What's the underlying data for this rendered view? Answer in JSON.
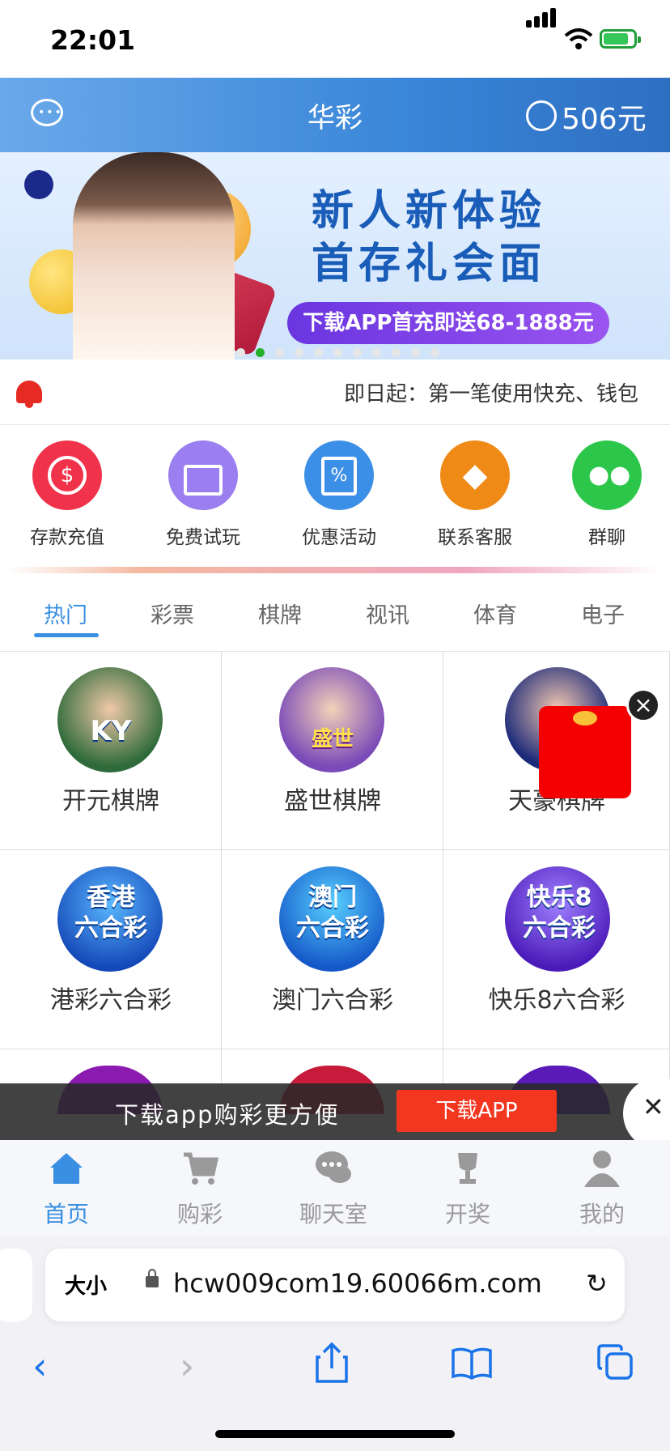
{
  "status": {
    "time": "22:01"
  },
  "header": {
    "title": "华彩",
    "balance": "506元",
    "chat_icon": "chat-icon",
    "user_icon": "user-icon"
  },
  "banner": {
    "line1": "新人新体验",
    "line2": "首存礼会面",
    "cta": "下载APP首充即送68-1888元",
    "active_slide": 2,
    "slide_count": 11
  },
  "notice": {
    "text": "即日起：第一笔使用快充、钱包"
  },
  "quick": [
    {
      "label": "存款充值",
      "icon": "coin-icon",
      "color": "#f0324a"
    },
    {
      "label": "免费试玩",
      "icon": "gift-icon",
      "color": "#9b7ef0"
    },
    {
      "label": "优惠活动",
      "icon": "coupon-icon",
      "color": "#3c8fe6"
    },
    {
      "label": "联系客服",
      "icon": "diamond-icon",
      "color": "#f08a17"
    },
    {
      "label": "群聊",
      "icon": "wechat-icon",
      "color": "#2cc74a"
    }
  ],
  "tabs": [
    "热门",
    "彩票",
    "棋牌",
    "视讯",
    "体育",
    "电子"
  ],
  "games": [
    {
      "name": "开元棋牌",
      "badge": "KY"
    },
    {
      "name": "盛世棋牌",
      "badge": "盛世"
    },
    {
      "name": "天豪棋牌",
      "badge": ""
    },
    {
      "name": "港彩六合彩",
      "badge": "香港\n六合彩"
    },
    {
      "name": "澳门六合彩",
      "badge": "澳门\n六合彩"
    },
    {
      "name": "快乐8六合彩",
      "badge": "快乐8\n六合彩"
    }
  ],
  "download_bar": {
    "message": "下载app购彩更方便",
    "button": "下载APP"
  },
  "bottom_nav": [
    {
      "label": "首页",
      "icon": "home-icon"
    },
    {
      "label": "购彩",
      "icon": "cart-icon"
    },
    {
      "label": "聊天室",
      "icon": "chat-bubble-icon"
    },
    {
      "label": "开奖",
      "icon": "trophy-icon"
    },
    {
      "label": "我的",
      "icon": "profile-icon"
    }
  ],
  "browser": {
    "text_size": "大小",
    "url": "hcw009com19.60066m.com"
  }
}
